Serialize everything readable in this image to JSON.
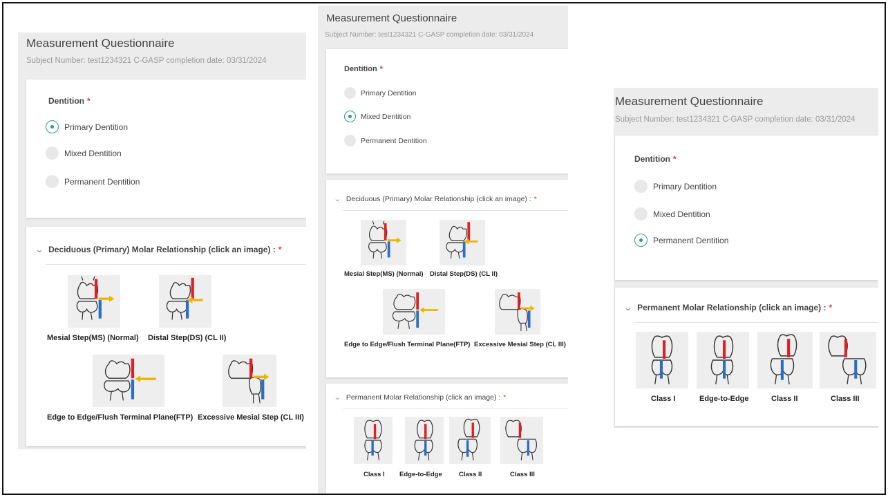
{
  "app": {
    "title": "Measurement Questionnaire",
    "subject_line": "Subject Number: test1234321 C-GASP completion date: 03/31/2024"
  },
  "colors": {
    "accent": "#2a9d84",
    "required": "#d23c3c",
    "marker_red": "#e02020",
    "marker_blue": "#2a6fc0",
    "marker_yellow": "#f0b400"
  },
  "dentition": {
    "label": "Dentition",
    "required_mark": "*",
    "options": [
      "Primary Dentition",
      "Mixed Dentition",
      "Permanent Dentition"
    ]
  },
  "deciduous": {
    "label": "Deciduous (Primary) Molar Relationship (click an image) :",
    "required_mark": "*",
    "images": [
      {
        "caption": "Mesial Step(MS) (Normal)",
        "icon": "mesial-step-tooth-icon"
      },
      {
        "caption": "Distal Step(DS) (CL II)",
        "icon": "distal-step-tooth-icon"
      },
      {
        "caption": "Edge to Edge/Flush Terminal Plane(FTP)",
        "icon": "flush-terminal-plane-tooth-icon"
      },
      {
        "caption": "Excessive Mesial Step (CL III)",
        "icon": "excessive-mesial-step-tooth-icon"
      }
    ]
  },
  "permanent": {
    "label": "Permanent Molar Relationship (click an image) :",
    "required_mark": "*",
    "images": [
      {
        "caption": "Class I",
        "icon": "class-1-tooth-icon"
      },
      {
        "caption": "Edge-to-Edge",
        "icon": "edge-to-edge-tooth-icon"
      },
      {
        "caption": "Class II",
        "icon": "class-2-tooth-icon"
      },
      {
        "caption": "Class III",
        "icon": "class-3-tooth-icon"
      }
    ]
  },
  "panels": [
    {
      "name": "primary",
      "selected_option": "Primary Dentition"
    },
    {
      "name": "mixed",
      "selected_option": "Mixed Dentition"
    },
    {
      "name": "permanent",
      "selected_option": "Permanent Dentition"
    }
  ]
}
